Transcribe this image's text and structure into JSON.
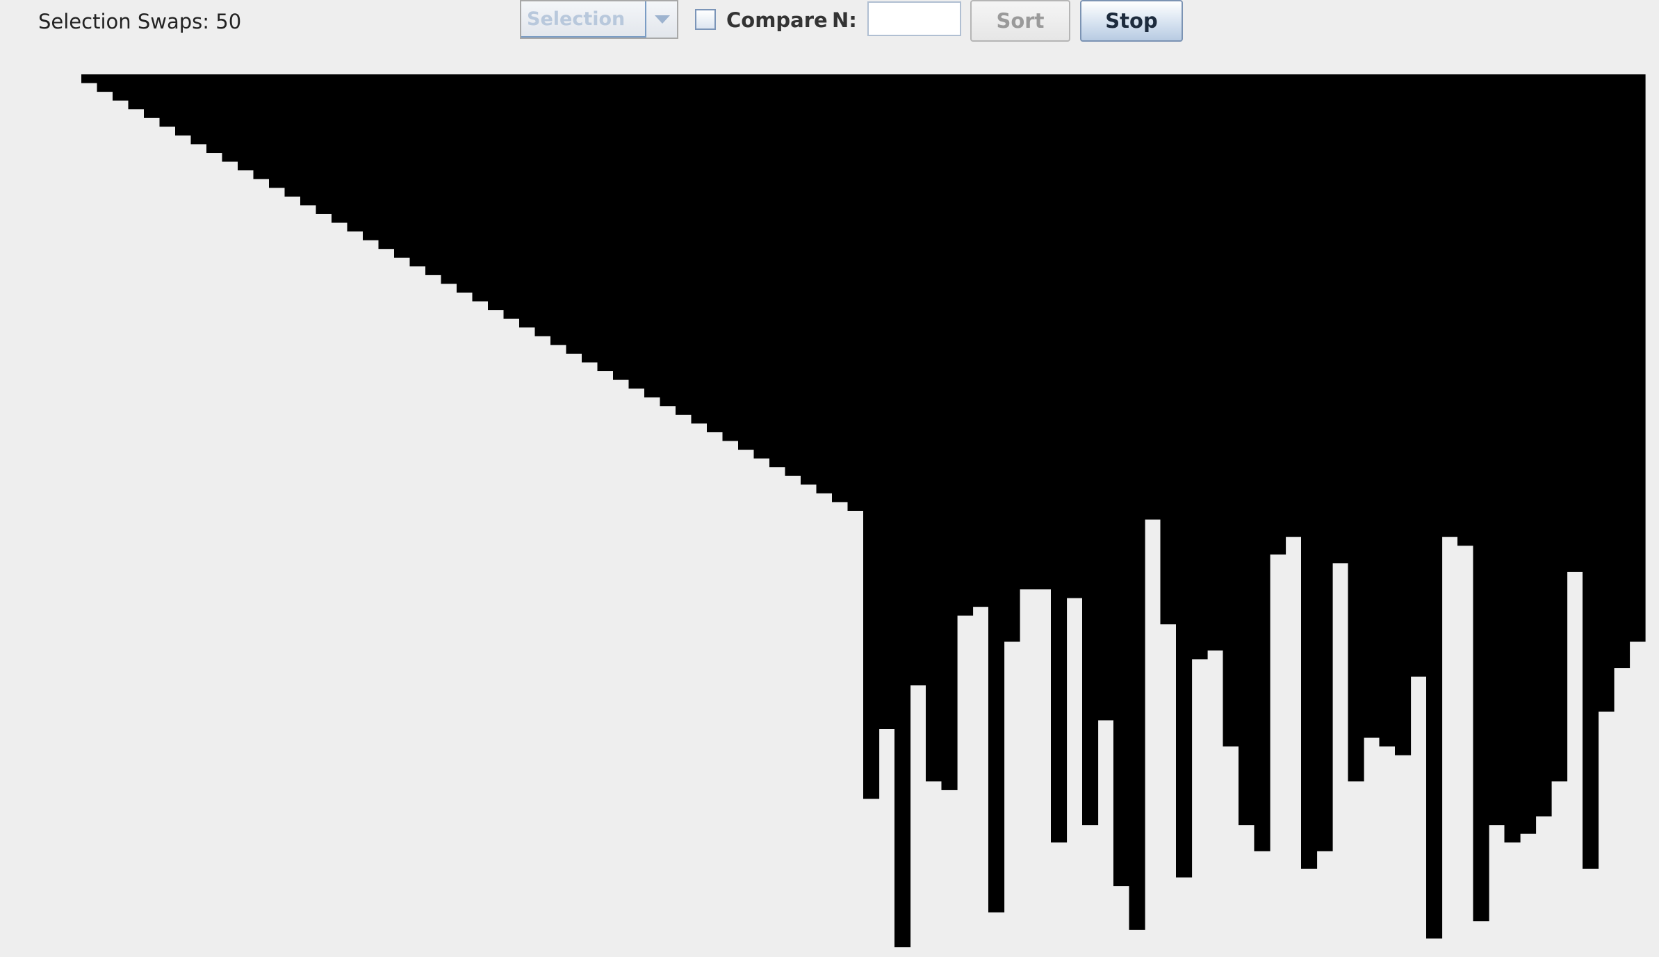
{
  "status": {
    "label": "Selection Swaps: 50"
  },
  "toolbar": {
    "algorithm_select": {
      "selected": "Selection"
    },
    "compare": {
      "label": "Compare",
      "checked": false
    },
    "n_field": {
      "label": "N:",
      "value": ""
    },
    "sort_button": {
      "label": "Sort",
      "enabled": false
    },
    "stop_button": {
      "label": "Stop",
      "enabled": true
    }
  },
  "visualization": {
    "bar_color": "#000000",
    "background_color": "#eeeeee",
    "sorted_count": 50,
    "max_value": 100,
    "values": [
      1,
      2,
      3,
      4,
      5,
      6,
      7,
      8,
      9,
      10,
      11,
      12,
      13,
      14,
      15,
      16,
      17,
      18,
      19,
      20,
      21,
      22,
      23,
      24,
      25,
      26,
      27,
      28,
      29,
      30,
      31,
      32,
      33,
      34,
      35,
      36,
      37,
      38,
      39,
      40,
      41,
      42,
      43,
      44,
      45,
      46,
      47,
      48,
      49,
      50,
      83,
      75,
      100,
      70,
      81,
      82,
      62,
      61,
      96,
      65,
      59,
      59,
      88,
      60,
      86,
      74,
      93,
      98,
      51,
      63,
      92,
      67,
      66,
      77,
      86,
      89,
      55,
      53,
      91,
      89,
      56,
      81,
      76,
      77,
      78,
      69,
      99,
      53,
      54,
      97,
      86,
      88,
      87,
      85,
      81,
      57,
      91,
      73,
      68,
      65
    ]
  }
}
